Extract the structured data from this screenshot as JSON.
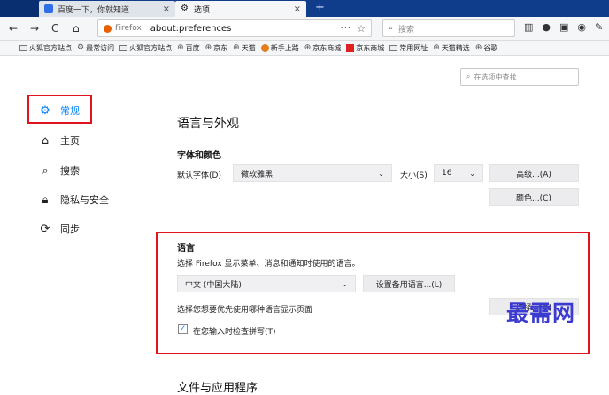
{
  "tabs": [
    {
      "label": "百度一下，你就知道",
      "close": "×"
    },
    {
      "label": "选项",
      "close": "×"
    }
  ],
  "new_tab": "+",
  "nav": {
    "back": "←",
    "forward": "→",
    "reload": "C",
    "home": "⌂",
    "identity": "Firefox",
    "url": "about:preferences",
    "more": "···",
    "bookmark_star": "☆",
    "search_placeholder": "搜索",
    "toolbar_icons": [
      "library-icon",
      "chat-icon",
      "sidebar-icon",
      "account-icon",
      "extensions-icon"
    ]
  },
  "bookmarks": [
    {
      "label": "火狐官方站点",
      "icon": "folder"
    },
    {
      "label": "最常访问",
      "icon": "gear"
    },
    {
      "label": "火狐官方站点",
      "icon": "folder"
    },
    {
      "label": "百度",
      "icon": "globe"
    },
    {
      "label": "京东",
      "icon": "globe"
    },
    {
      "label": "天猫",
      "icon": "globe"
    },
    {
      "label": "新手上路",
      "icon": "firefox"
    },
    {
      "label": "京东商城",
      "icon": "globe"
    },
    {
      "label": "京东商城",
      "icon": "jd"
    },
    {
      "label": "常用网址",
      "icon": "folder"
    },
    {
      "label": "天猫精选",
      "icon": "globe"
    },
    {
      "label": "谷歌",
      "icon": "globe"
    }
  ],
  "find_placeholder": "在选项中查找",
  "sidebar": {
    "items": [
      {
        "label": "常规",
        "icon": "gear-icon"
      },
      {
        "label": "主页",
        "icon": "home-icon"
      },
      {
        "label": "搜索",
        "icon": "search-icon"
      },
      {
        "label": "隐私与安全",
        "icon": "lock-icon"
      },
      {
        "label": "同步",
        "icon": "sync-icon"
      }
    ]
  },
  "main": {
    "section_title": "语言与外观",
    "fonts": {
      "title": "字体和颜色",
      "default_font_label": "默认字体(D)",
      "default_font_value": "微软雅黑",
      "size_label": "大小(S)",
      "size_value": "16",
      "advanced_button": "高级...(A)",
      "colors_button": "颜色...(C)"
    },
    "language": {
      "title": "语言",
      "description": "选择 Firefox 显示菜单、消息和通知时使用的语言。",
      "selected_language": "中文 (中国大陆)",
      "alternatives_button": "设置备用语言...(L)",
      "page_language_text": "选择您想要优先使用哪种语言显示页面",
      "choose_button": "选择...(O)",
      "spellcheck_label": "在您输入时检查拼写(T)",
      "spellcheck_checked": true
    },
    "next_section_title": "文件与应用程序"
  },
  "watermark": "最需网"
}
